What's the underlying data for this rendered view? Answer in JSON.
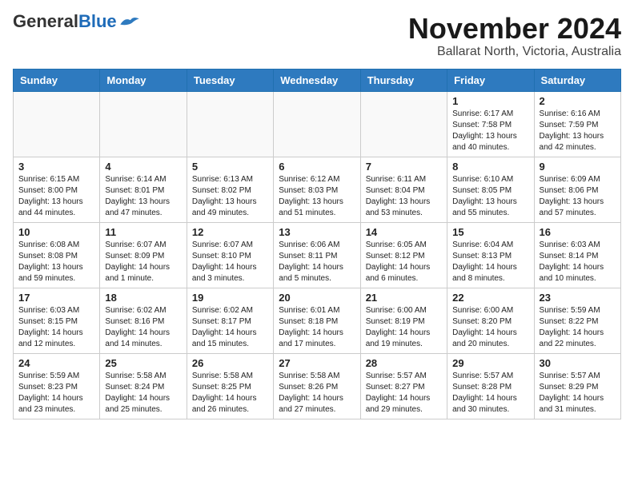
{
  "header": {
    "logo_general": "General",
    "logo_blue": "Blue",
    "title": "November 2024",
    "subtitle": "Ballarat North, Victoria, Australia"
  },
  "weekdays": [
    "Sunday",
    "Monday",
    "Tuesday",
    "Wednesday",
    "Thursday",
    "Friday",
    "Saturday"
  ],
  "weeks": [
    [
      {
        "day": "",
        "info": ""
      },
      {
        "day": "",
        "info": ""
      },
      {
        "day": "",
        "info": ""
      },
      {
        "day": "",
        "info": ""
      },
      {
        "day": "",
        "info": ""
      },
      {
        "day": "1",
        "info": "Sunrise: 6:17 AM\nSunset: 7:58 PM\nDaylight: 13 hours\nand 40 minutes."
      },
      {
        "day": "2",
        "info": "Sunrise: 6:16 AM\nSunset: 7:59 PM\nDaylight: 13 hours\nand 42 minutes."
      }
    ],
    [
      {
        "day": "3",
        "info": "Sunrise: 6:15 AM\nSunset: 8:00 PM\nDaylight: 13 hours\nand 44 minutes."
      },
      {
        "day": "4",
        "info": "Sunrise: 6:14 AM\nSunset: 8:01 PM\nDaylight: 13 hours\nand 47 minutes."
      },
      {
        "day": "5",
        "info": "Sunrise: 6:13 AM\nSunset: 8:02 PM\nDaylight: 13 hours\nand 49 minutes."
      },
      {
        "day": "6",
        "info": "Sunrise: 6:12 AM\nSunset: 8:03 PM\nDaylight: 13 hours\nand 51 minutes."
      },
      {
        "day": "7",
        "info": "Sunrise: 6:11 AM\nSunset: 8:04 PM\nDaylight: 13 hours\nand 53 minutes."
      },
      {
        "day": "8",
        "info": "Sunrise: 6:10 AM\nSunset: 8:05 PM\nDaylight: 13 hours\nand 55 minutes."
      },
      {
        "day": "9",
        "info": "Sunrise: 6:09 AM\nSunset: 8:06 PM\nDaylight: 13 hours\nand 57 minutes."
      }
    ],
    [
      {
        "day": "10",
        "info": "Sunrise: 6:08 AM\nSunset: 8:08 PM\nDaylight: 13 hours\nand 59 minutes."
      },
      {
        "day": "11",
        "info": "Sunrise: 6:07 AM\nSunset: 8:09 PM\nDaylight: 14 hours\nand 1 minute."
      },
      {
        "day": "12",
        "info": "Sunrise: 6:07 AM\nSunset: 8:10 PM\nDaylight: 14 hours\nand 3 minutes."
      },
      {
        "day": "13",
        "info": "Sunrise: 6:06 AM\nSunset: 8:11 PM\nDaylight: 14 hours\nand 5 minutes."
      },
      {
        "day": "14",
        "info": "Sunrise: 6:05 AM\nSunset: 8:12 PM\nDaylight: 14 hours\nand 6 minutes."
      },
      {
        "day": "15",
        "info": "Sunrise: 6:04 AM\nSunset: 8:13 PM\nDaylight: 14 hours\nand 8 minutes."
      },
      {
        "day": "16",
        "info": "Sunrise: 6:03 AM\nSunset: 8:14 PM\nDaylight: 14 hours\nand 10 minutes."
      }
    ],
    [
      {
        "day": "17",
        "info": "Sunrise: 6:03 AM\nSunset: 8:15 PM\nDaylight: 14 hours\nand 12 minutes."
      },
      {
        "day": "18",
        "info": "Sunrise: 6:02 AM\nSunset: 8:16 PM\nDaylight: 14 hours\nand 14 minutes."
      },
      {
        "day": "19",
        "info": "Sunrise: 6:02 AM\nSunset: 8:17 PM\nDaylight: 14 hours\nand 15 minutes."
      },
      {
        "day": "20",
        "info": "Sunrise: 6:01 AM\nSunset: 8:18 PM\nDaylight: 14 hours\nand 17 minutes."
      },
      {
        "day": "21",
        "info": "Sunrise: 6:00 AM\nSunset: 8:19 PM\nDaylight: 14 hours\nand 19 minutes."
      },
      {
        "day": "22",
        "info": "Sunrise: 6:00 AM\nSunset: 8:20 PM\nDaylight: 14 hours\nand 20 minutes."
      },
      {
        "day": "23",
        "info": "Sunrise: 5:59 AM\nSunset: 8:22 PM\nDaylight: 14 hours\nand 22 minutes."
      }
    ],
    [
      {
        "day": "24",
        "info": "Sunrise: 5:59 AM\nSunset: 8:23 PM\nDaylight: 14 hours\nand 23 minutes."
      },
      {
        "day": "25",
        "info": "Sunrise: 5:58 AM\nSunset: 8:24 PM\nDaylight: 14 hours\nand 25 minutes."
      },
      {
        "day": "26",
        "info": "Sunrise: 5:58 AM\nSunset: 8:25 PM\nDaylight: 14 hours\nand 26 minutes."
      },
      {
        "day": "27",
        "info": "Sunrise: 5:58 AM\nSunset: 8:26 PM\nDaylight: 14 hours\nand 27 minutes."
      },
      {
        "day": "28",
        "info": "Sunrise: 5:57 AM\nSunset: 8:27 PM\nDaylight: 14 hours\nand 29 minutes."
      },
      {
        "day": "29",
        "info": "Sunrise: 5:57 AM\nSunset: 8:28 PM\nDaylight: 14 hours\nand 30 minutes."
      },
      {
        "day": "30",
        "info": "Sunrise: 5:57 AM\nSunset: 8:29 PM\nDaylight: 14 hours\nand 31 minutes."
      }
    ]
  ]
}
